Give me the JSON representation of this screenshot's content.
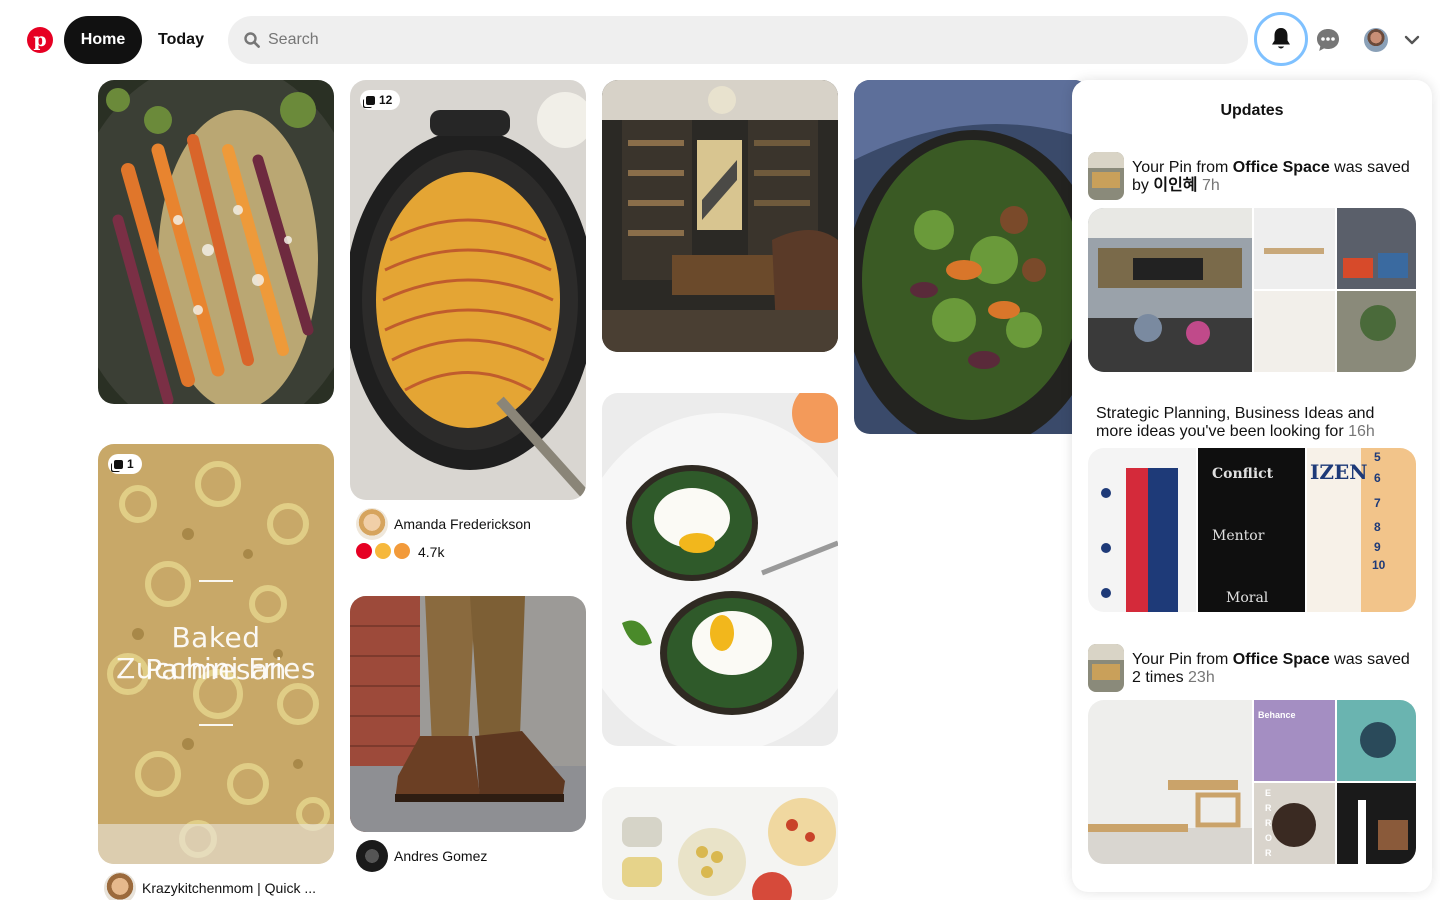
{
  "header": {
    "logo_letter": "p",
    "nav": {
      "home": "Home",
      "today": "Today"
    },
    "search": {
      "placeholder": "Search",
      "value": ""
    }
  },
  "icons": {
    "logo": "pinterest-logo",
    "search": "search-icon",
    "notifications": "bell-icon",
    "messages": "chat-bubble-icon",
    "account_menu": "chevron-down-icon",
    "board": "stack-icon"
  },
  "colors": {
    "brand": "#e60023",
    "nav_active_bg": "#111111",
    "search_bg": "#efefef",
    "focus_ring": "#7fc1ff",
    "muted_text": "#767676"
  },
  "pins": {
    "potato": {
      "badge_count": "12",
      "author": "Amanda Frederickson",
      "reaction_count": "4.7k",
      "reactions": [
        "heart",
        "heart-eyes",
        "wow"
      ]
    },
    "zucchini": {
      "badge_count": "1",
      "overlay_title_line1": "Baked Parmesan",
      "overlay_title_line2": "Zucchini Fries",
      "author": "Krazykitchenmom | Quick ..."
    },
    "boots": {
      "author": "Andres Gomez"
    }
  },
  "updates": {
    "title": "Updates",
    "items": [
      {
        "pre": "Your Pin from ",
        "board": "Office Space",
        "mid": " was saved by ",
        "user": "이인혜",
        "time": "7h"
      },
      {
        "text": "Strategic Planning, Business Ideas and more ideas you've been looking for ",
        "time": "16h"
      },
      {
        "pre": "Your Pin from ",
        "board": "Office Space",
        "mid": " was saved 2 times",
        "time": "23h"
      }
    ],
    "collage_2": {
      "tile2_heading": "Conflict",
      "tile2_sub": "Mentor",
      "tile2_bottom": "Moral",
      "tile3_heading": "IZEN",
      "tile3_numbers": [
        "5",
        "6",
        "7",
        "8",
        "9",
        "10"
      ]
    },
    "collage_3": {
      "tile2_label": "Behance",
      "tile4_letters": [
        "E",
        "R",
        "R",
        "O",
        "R"
      ]
    }
  }
}
